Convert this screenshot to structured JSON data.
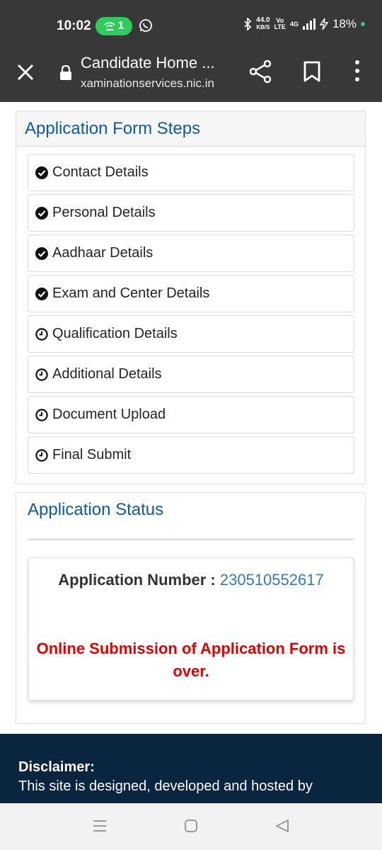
{
  "status_bar": {
    "time": "10:02",
    "hotspot_count": "1",
    "speed_value": "44.0",
    "speed_unit": "KB/S",
    "volte_top": "Vo",
    "volte_bottom": "LTE",
    "network": "4G",
    "battery": "18%"
  },
  "browser": {
    "title": "Candidate Home ...",
    "url": "xaminationservices.nic.in"
  },
  "steps_panel": {
    "title": "Application Form Steps",
    "steps": [
      {
        "label": "Contact Details",
        "state": "done"
      },
      {
        "label": "Personal Details",
        "state": "done"
      },
      {
        "label": "Aadhaar Details",
        "state": "done"
      },
      {
        "label": "Exam and Center Details",
        "state": "done"
      },
      {
        "label": "Qualification Details",
        "state": "pending"
      },
      {
        "label": "Additional Details",
        "state": "pending"
      },
      {
        "label": "Document Upload",
        "state": "pending"
      },
      {
        "label": "Final Submit",
        "state": "pending"
      }
    ]
  },
  "status_panel": {
    "title": "Application Status",
    "app_number_label": "Application Number :",
    "app_number": "230510552617",
    "message": "Online Submission of Application Form is over."
  },
  "footer": {
    "disclaimer_title": "Disclaimer:",
    "disclaimer_text": "This site is designed, developed and hosted by"
  },
  "colors": {
    "heading_blue": "#0d5aa7",
    "link_blue": "#337ab7",
    "alert_red": "#e10000",
    "footer_bg": "#0a2540",
    "chrome_bg": "#383838"
  },
  "icons": {
    "done": "check-circle-icon",
    "pending": "clock-icon"
  }
}
